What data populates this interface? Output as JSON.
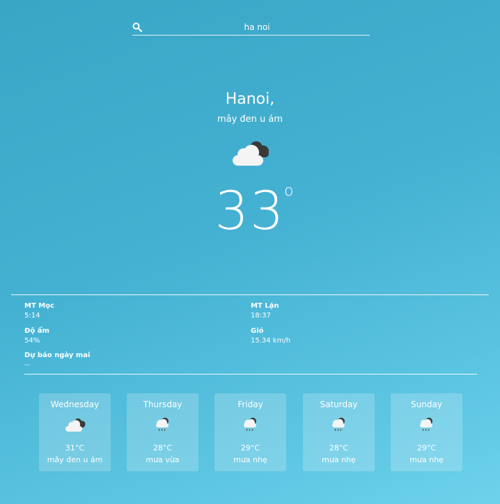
{
  "search": {
    "value": "ha noi",
    "icon": "search-icon"
  },
  "current": {
    "city": "Hanoi,",
    "description": "mây đen u ám",
    "icon": "overcast-cloud-icon",
    "temperature": "33",
    "degree_symbol": "o"
  },
  "details": [
    {
      "label": "MT Mọc",
      "value": "5:14"
    },
    {
      "label": "MT Lặn",
      "value": "18:37"
    },
    {
      "label": "Độ ẩm",
      "value": "54%"
    },
    {
      "label": "Gió",
      "value": "15.34 km/h"
    },
    {
      "label": "Dự báo ngày mai",
      "value": "--"
    }
  ],
  "forecast": [
    {
      "day": "Wednesday",
      "temp": "31°C",
      "desc": "mây đen u ám",
      "icon": "overcast-cloud-icon"
    },
    {
      "day": "Thursday",
      "temp": "28°C",
      "desc": "mưa vừa",
      "icon": "rain-cloud-icon"
    },
    {
      "day": "Friday",
      "temp": "29°C",
      "desc": "mưa nhẹ",
      "icon": "rain-cloud-icon"
    },
    {
      "day": "Saturday",
      "temp": "28°C",
      "desc": "mưa nhẹ",
      "icon": "rain-cloud-icon"
    },
    {
      "day": "Sunday",
      "temp": "29°C",
      "desc": "mưa nhẹ",
      "icon": "rain-cloud-icon"
    }
  ],
  "colors": {
    "background_top": "#3aa6c6",
    "background_bottom": "#6dd2ec",
    "text": "#ffffff"
  }
}
